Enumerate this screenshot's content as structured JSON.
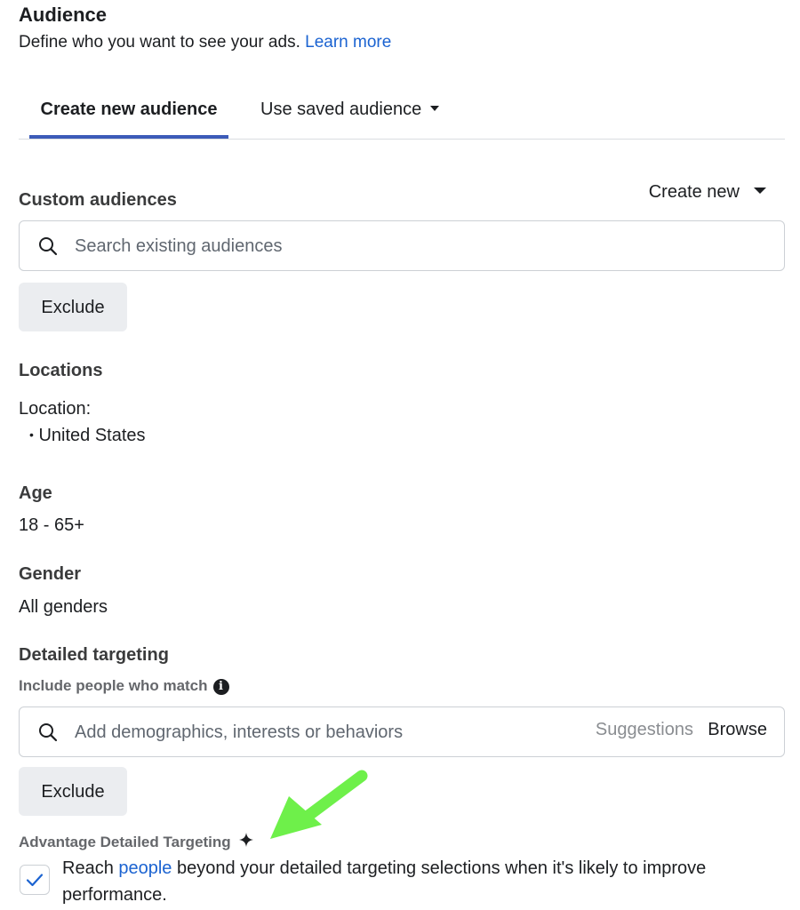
{
  "header": {
    "title": "Audience",
    "subtitle": "Define who you want to see your ads.",
    "learn_more": "Learn more"
  },
  "tabs": {
    "create_new": "Create new audience",
    "use_saved": "Use saved audience"
  },
  "custom_audiences": {
    "label": "Custom audiences",
    "create_new": "Create new",
    "search_placeholder": "Search existing audiences",
    "exclude": "Exclude"
  },
  "locations": {
    "label": "Locations",
    "sub_label": "Location:",
    "items": [
      "United States"
    ]
  },
  "age": {
    "label": "Age",
    "value": "18 - 65+"
  },
  "gender": {
    "label": "Gender",
    "value": "All genders"
  },
  "detailed_targeting": {
    "label": "Detailed targeting",
    "include_label": "Include people who match",
    "search_placeholder": "Add demographics, interests or behaviors",
    "suggestions": "Suggestions",
    "browse": "Browse",
    "exclude": "Exclude"
  },
  "advantage": {
    "label": "Advantage Detailed Targeting",
    "checked": true,
    "text_before": "Reach",
    "link": "people",
    "text_after": "beyond your detailed targeting selections when it's likely to improve performance."
  },
  "colors": {
    "link": "#1b63d1",
    "tab_underline": "#3c5bb8",
    "annotation_arrow": "#6ef04a",
    "check": "#1b63d1"
  },
  "icons": [
    "search-icon",
    "caret-down-icon",
    "info-icon",
    "sparkle-icon",
    "check-icon",
    "annotation-arrow"
  ]
}
